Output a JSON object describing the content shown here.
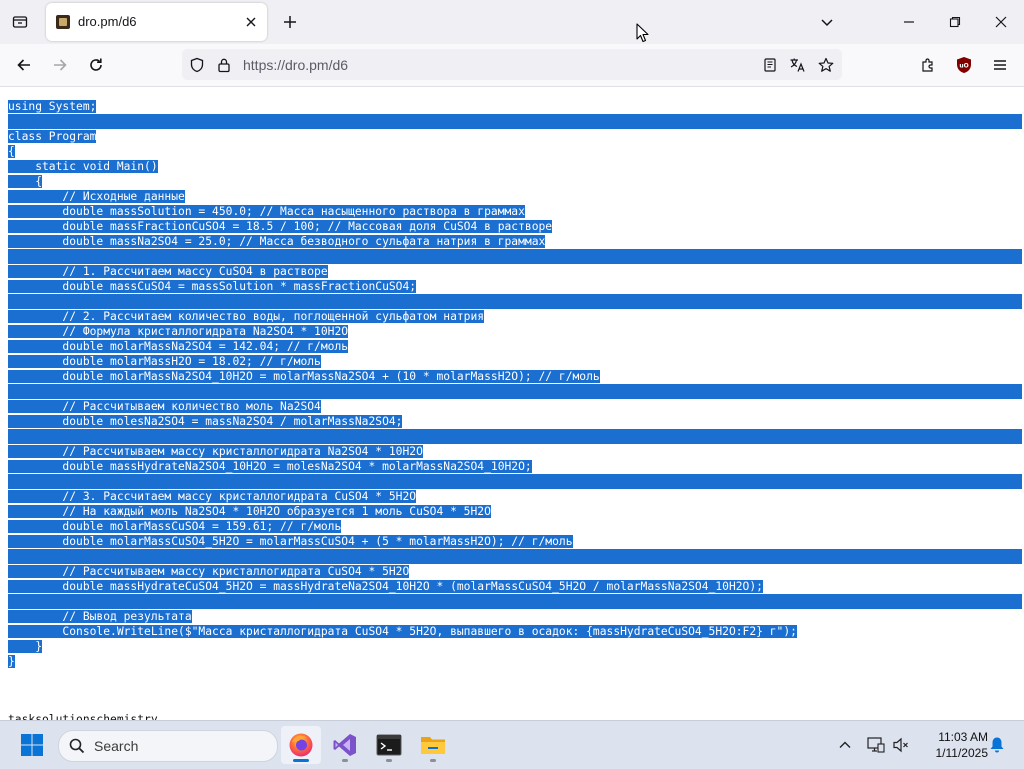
{
  "browser": {
    "tab": {
      "title": "dro.pm/d6"
    },
    "url": "https://dro.pm/d6"
  },
  "code_lines": [
    "using System;",
    "",
    "class Program",
    "{",
    "    static void Main()",
    "    {",
    "        // Исходные данные",
    "        double massSolution = 450.0; // Масса насыщенного раствора в граммах",
    "        double massFractionCuSO4 = 18.5 / 100; // Массовая доля CuSO4 в растворе",
    "        double massNa2SO4 = 25.0; // Масса безводного сульфата натрия в граммах",
    "",
    "        // 1. Рассчитаем массу CuSO4 в растворе",
    "        double massCuSO4 = massSolution * massFractionCuSO4;",
    "",
    "        // 2. Рассчитаем количество воды, поглощенной сульфатом натрия",
    "        // Формула кристаллогидрата Na2SO4 * 10H2O",
    "        double molarMassNa2SO4 = 142.04; // г/моль",
    "        double molarMassH2O = 18.02; // г/моль",
    "        double molarMassNa2SO4_10H2O = molarMassNa2SO4 + (10 * molarMassH2O); // г/моль",
    "",
    "        // Рассчитываем количество моль Na2SO4",
    "        double molesNa2SO4 = massNa2SO4 / molarMassNa2SO4;",
    "",
    "        // Рассчитываем массу кристаллогидрата Na2SO4 * 10H2O",
    "        double massHydrateNa2SO4_10H2O = molesNa2SO4 * molarMassNa2SO4_10H2O;",
    "",
    "        // 3. Рассчитаем массу кристаллогидрата CuSO4 * 5H2O",
    "        // На каждый моль Na2SO4 * 10H2O образуется 1 моль CuSO4 * 5H2O",
    "        double molarMassCuSO4 = 159.61; // г/моль",
    "        double molarMassCuSO4_5H2O = molarMassCuSO4 + (5 * molarMassH2O); // г/моль",
    "",
    "        // Рассчитываем массу кристаллогидрата CuSO4 * 5H2O",
    "        double massHydrateCuSO4_5H2O = massHydrateNa2SO4_10H2O * (molarMassCuSO4_5H2O / molarMassNa2SO4_10H2O);",
    "",
    "        // Вывод результата",
    "        Console.WriteLine($\"Масса кристаллогидрата CuSO4 * 5H2O, выпавшего в осадок: {massHydrateCuSO4_5H2O:F2} г\");",
    "    }",
    "}"
  ],
  "footer_text": "tasksolutionschemistry",
  "taskbar": {
    "search_label": "Search",
    "time": "11:03 AM",
    "date": "1/11/2025"
  },
  "colors": {
    "selection": "#1a6fd1",
    "accent_firefox": "#ff7139"
  }
}
